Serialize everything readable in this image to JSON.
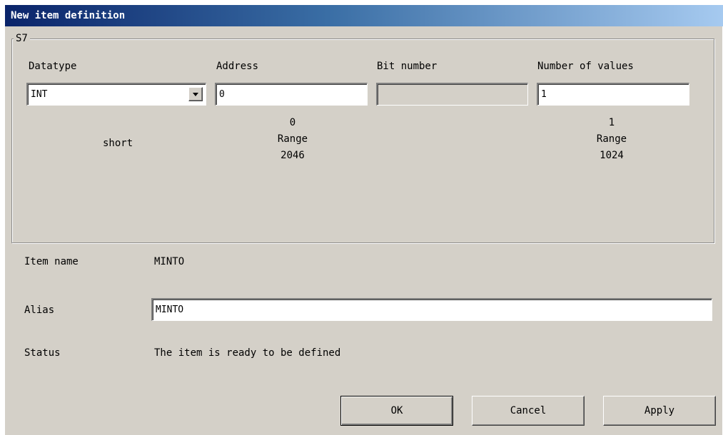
{
  "window": {
    "title": "New item definition"
  },
  "group": {
    "legend": "S7",
    "columns": {
      "datatype": {
        "label": "Datatype",
        "value": "INT",
        "info": "short"
      },
      "address": {
        "label": "Address",
        "value": "0",
        "range_min": "0",
        "range_label": "Range",
        "range_max": "2046"
      },
      "bit_number": {
        "label": "Bit number",
        "value": ""
      },
      "number_of_values": {
        "label": "Number of values",
        "value": "1",
        "range_min": "1",
        "range_label": "Range",
        "range_max": "1024"
      }
    }
  },
  "item_name": {
    "label": "Item name",
    "value": "MINTO"
  },
  "alias": {
    "label": "Alias",
    "value": "MINTO"
  },
  "status": {
    "label": "Status",
    "value": "The item is ready to be defined"
  },
  "buttons": {
    "ok": "OK",
    "cancel": "Cancel",
    "apply": "Apply"
  },
  "icons": {
    "dropdown": "chevron-down-icon"
  },
  "colors": {
    "dialog_face": "#d4d0c8",
    "title_start": "#0a246a",
    "title_end": "#a6caf0"
  }
}
